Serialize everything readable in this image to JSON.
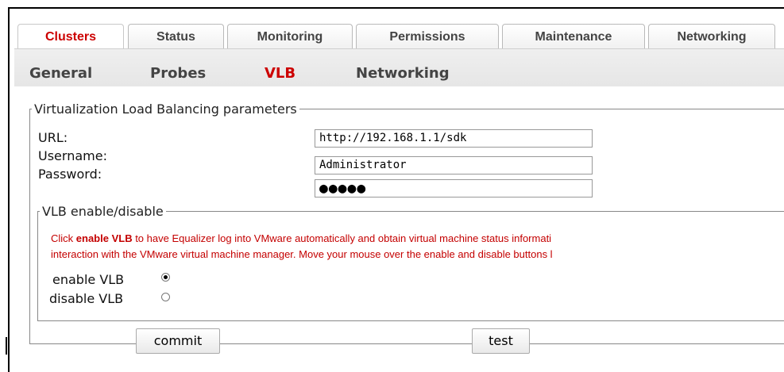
{
  "tabs": [
    {
      "label": "Clusters",
      "active": true
    },
    {
      "label": "Status",
      "active": false
    },
    {
      "label": "Monitoring",
      "active": false
    },
    {
      "label": "Permissions",
      "active": false
    },
    {
      "label": "Maintenance",
      "active": false
    },
    {
      "label": "Networking",
      "active": false
    }
  ],
  "subtabs": [
    {
      "label": "General",
      "active": false
    },
    {
      "label": "Probes",
      "active": false
    },
    {
      "label": "VLB",
      "active": true
    },
    {
      "label": "Networking",
      "active": false
    }
  ],
  "params": {
    "legend": "Virtualization Load Balancing parameters",
    "url_label": "URL:",
    "url_value": "http://192.168.1.1/sdk",
    "username_label": "Username:",
    "username_value": "Administrator",
    "password_label": "Password:",
    "password_value": "●●●●●"
  },
  "vlb": {
    "legend": "VLB enable/disable",
    "message_pre": "Click ",
    "message_bold": "enable VLB",
    "message_post": " to have Equalizer log into VMware automatically and obtain virtual machine status informati",
    "message_line2": "interaction with the VMware virtual machine manager. Move your mouse over the enable and disable buttons l",
    "enable_label": "enable VLB",
    "disable_label": "disable VLB",
    "selected": "enable"
  },
  "buttons": {
    "commit": "commit",
    "test": "test"
  },
  "colors": {
    "active_tab": "#cc0000",
    "message_text": "#c40000"
  }
}
